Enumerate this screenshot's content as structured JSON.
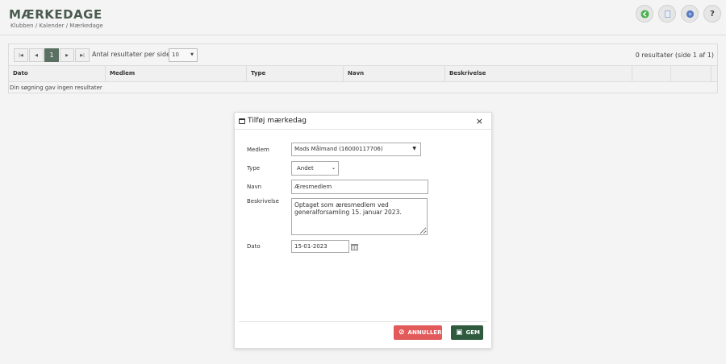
{
  "header": {
    "title": "MÆRKEDAGE",
    "breadcrumb": "Klubben / Kalender / Mærkedage",
    "actions": {
      "back_icon": "arrow-left-icon",
      "document_icon": "document-icon",
      "info_icon": "info-icon",
      "help_label": "?"
    }
  },
  "pager": {
    "first_icon": "first-page-icon",
    "prev_icon": "prev-page-icon",
    "current_page": "1",
    "next_icon": "next-page-icon",
    "last_icon": "last-page-icon",
    "per_page_label": "Antal resultater per side",
    "per_page_value": "10",
    "result_count": "0 resultater (side 1 af 1)"
  },
  "table": {
    "columns": [
      "Dato",
      "Medlem",
      "Type",
      "Navn",
      "Beskrivelse",
      "",
      ""
    ],
    "empty_message": "Din søgning gav ingen resultater"
  },
  "modal": {
    "title": "Tilføj mærkedag",
    "close_label": "×",
    "fields": {
      "medlem_label": "Medlem",
      "medlem_value": "Mads Målmand (16000117706)",
      "type_label": "Type",
      "type_value": "Andet",
      "navn_label": "Navn",
      "navn_value": "Æresmedlem",
      "beskrivelse_label": "Beskrivelse",
      "beskrivelse_value": "Optaget som æresmedlem ved generalforsamling 15. januar 2023.",
      "dato_label": "Dato",
      "dato_value": "15-01-2023"
    },
    "buttons": {
      "cancel_label": "ANNULLER",
      "save_label": "GEM"
    }
  },
  "colors": {
    "cancel": "#e25a5a",
    "save": "#2f5a3e",
    "active_page": "#5b6f63"
  }
}
